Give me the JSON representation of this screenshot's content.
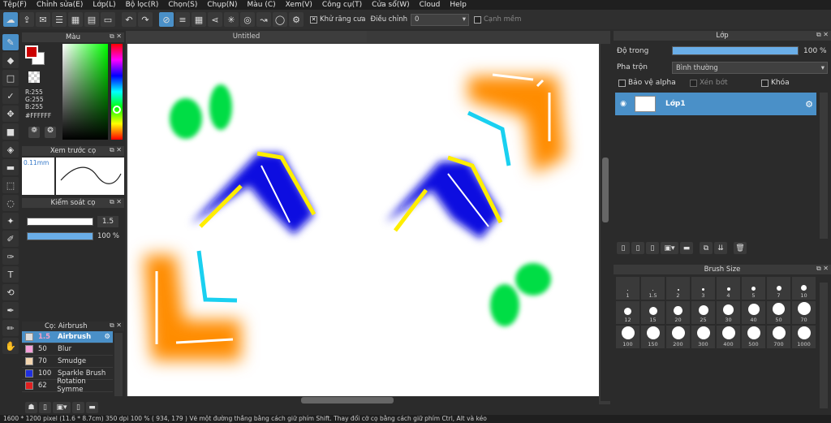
{
  "menu": [
    "Tệp(F)",
    "Chỉnh sửa(E)",
    "Lớp(L)",
    "Bộ lọc(R)",
    "Chọn(S)",
    "Chụp(N)",
    "Màu (C)",
    "Xem(V)",
    "Công cụ(T)",
    "Cửa sổ(W)",
    "Cloud",
    "Help"
  ],
  "toolbar": {
    "antialias_label": "Khử răng cưa",
    "adjust_label": "Điều chỉnh",
    "adjust_value": "0",
    "smooth_edge_label": "Cạnh mềm"
  },
  "color_panel": {
    "title": "Màu",
    "r": "R:255",
    "g": "G:255",
    "b": "B:255",
    "hex": "#FFFFFF",
    "fg_color": "#cc0000",
    "bg_color": "#ffffff"
  },
  "brush_preview": {
    "title": "Xem trước cọ",
    "size": "0.11mm"
  },
  "brush_control": {
    "title": "Kiểm soát cọ",
    "size_value": "1.5",
    "opacity_value": "100 %"
  },
  "brush_list": {
    "title": "Cọ: Airbrush",
    "items": [
      {
        "num": "1.5",
        "name": "Airbrush",
        "color": "#dddddd",
        "selected": true
      },
      {
        "num": "50",
        "name": "Blur",
        "color": "#f5a0d8",
        "selected": false
      },
      {
        "num": "70",
        "name": "Smudge",
        "color": "#f4d6b0",
        "selected": false
      },
      {
        "num": "100",
        "name": "Sparkle Brush",
        "color": "#2030e0",
        "selected": false
      },
      {
        "num": "62",
        "name": "Rotation Symme",
        "color": "#e02020",
        "selected": false
      }
    ]
  },
  "canvas": {
    "tab_title": "Untitled"
  },
  "layer_panel": {
    "title": "Lớp",
    "opacity_label": "Độ trong",
    "opacity_value": "100 %",
    "blend_label": "Pha trộn",
    "blend_value": "Bình thường",
    "protect_alpha_label": "Bảo vệ alpha",
    "clipping_label": "Xén bớt",
    "lock_label": "Khóa",
    "layer_name": "Lớp1"
  },
  "brush_size_panel": {
    "title": "Brush Size",
    "sizes": [
      "1",
      "1.5",
      "2",
      "3",
      "4",
      "5",
      "7",
      "10",
      "12",
      "15",
      "20",
      "25",
      "30",
      "40",
      "50",
      "70",
      "100",
      "150",
      "200",
      "300",
      "400",
      "500",
      "700",
      "1000"
    ]
  },
  "statusbar": "1600 * 1200 pixel   (11.6 * 8.7cm)   350 dpi   100 %   ( 934, 179 )   Vẽ một đường thẳng bằng cách giữ phím Shift. Thay đổi cỡ cọ bằng cách giữ phím Ctrl, Alt và kéo"
}
